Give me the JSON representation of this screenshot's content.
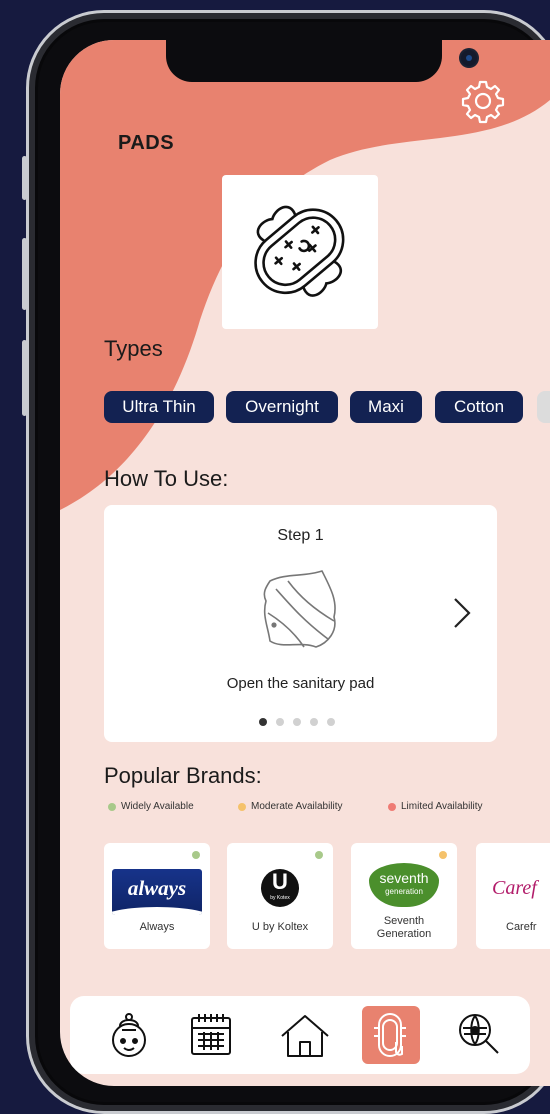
{
  "header": {
    "title": "PADS"
  },
  "types": {
    "label": "Types",
    "chips": [
      "Ultra Thin",
      "Overnight",
      "Maxi",
      "Cotton"
    ]
  },
  "how_to_use": {
    "label": "How To Use:",
    "step_title": "Step 1",
    "step_caption": "Open the sanitary pad",
    "total_steps": 5,
    "current_step": 1
  },
  "popular_brands": {
    "label": "Popular Brands:",
    "legend": [
      {
        "label": "Widely Available",
        "color": "#a8c98a"
      },
      {
        "label": "Moderate Availability",
        "color": "#f5c26b"
      },
      {
        "label": "Limited Availability",
        "color": "#ef7b74"
      }
    ],
    "brands": [
      {
        "name": "Always",
        "logo_text": "always",
        "availability": "Widely Available"
      },
      {
        "name": "U by Koltex",
        "logo_text": "U",
        "logo_subtext": "by Kotex",
        "availability": "Widely Available"
      },
      {
        "name": "Seventh Generation",
        "name_line1": "Seventh",
        "name_line2": "Generation",
        "logo_text": "seventh",
        "logo_subtext": "generation",
        "availability": "Moderate Availability"
      },
      {
        "name": "Carefr",
        "logo_text": "Caref",
        "availability": "Widely Available"
      }
    ]
  },
  "nav": {
    "items": [
      "chatbot-icon",
      "calendar-icon",
      "home-icon",
      "pad-icon",
      "search-location-icon"
    ],
    "active": "pad-icon"
  },
  "colors": {
    "accent": "#e8826f",
    "background": "#f8e1db",
    "chip": "#132252",
    "frame_bg": "#161a3f"
  }
}
